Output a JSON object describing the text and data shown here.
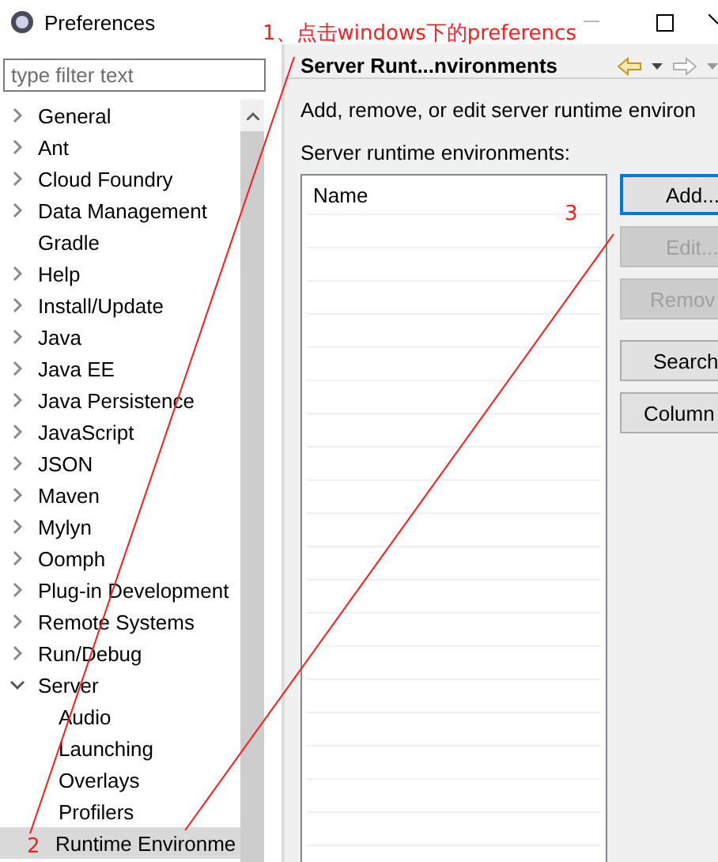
{
  "window": {
    "title": "Preferences"
  },
  "filter": {
    "placeholder": "type filter text"
  },
  "tree": [
    {
      "label": "General",
      "expanded": false
    },
    {
      "label": "Ant",
      "expanded": false
    },
    {
      "label": "Cloud Foundry",
      "expanded": false
    },
    {
      "label": "Data Management",
      "expanded": false
    },
    {
      "label": "Gradle"
    },
    {
      "label": "Help",
      "expanded": false
    },
    {
      "label": "Install/Update",
      "expanded": false
    },
    {
      "label": "Java",
      "expanded": false
    },
    {
      "label": "Java EE",
      "expanded": false
    },
    {
      "label": "Java Persistence",
      "expanded": false
    },
    {
      "label": "JavaScript",
      "expanded": false
    },
    {
      "label": "JSON",
      "expanded": false
    },
    {
      "label": "Maven",
      "expanded": false
    },
    {
      "label": "Mylyn",
      "expanded": false
    },
    {
      "label": "Oomph",
      "expanded": false
    },
    {
      "label": "Plug-in Development",
      "expanded": false
    },
    {
      "label": "Remote Systems",
      "expanded": false
    },
    {
      "label": "Run/Debug",
      "expanded": false
    },
    {
      "label": "Server",
      "expanded": true,
      "children": [
        {
          "label": "Audio",
          "selected": false
        },
        {
          "label": "Launching",
          "selected": false
        },
        {
          "label": "Overlays",
          "selected": false
        },
        {
          "label": "Profilers",
          "selected": false
        },
        {
          "label": "Runtime Environme",
          "selected": true
        }
      ]
    }
  ],
  "page": {
    "title": "Server Runt...nvironments",
    "description": "Add, remove, or edit server runtime environ",
    "list_label": "Server runtime environments:",
    "table": {
      "columns": [
        "Name"
      ]
    },
    "buttons": [
      {
        "label": "Add...",
        "disabled": false,
        "focused": true
      },
      {
        "label": "Edit...",
        "disabled": true,
        "focused": false
      },
      {
        "label": "Remov",
        "disabled": true,
        "focused": false
      },
      {
        "label": "Search",
        "disabled": false,
        "focused": false
      },
      {
        "label": "Column",
        "disabled": false,
        "focused": false
      }
    ]
  },
  "annotations": [
    {
      "text": "1、点击windows下的preferencs"
    },
    {
      "text": "2"
    },
    {
      "text": "3"
    }
  ]
}
